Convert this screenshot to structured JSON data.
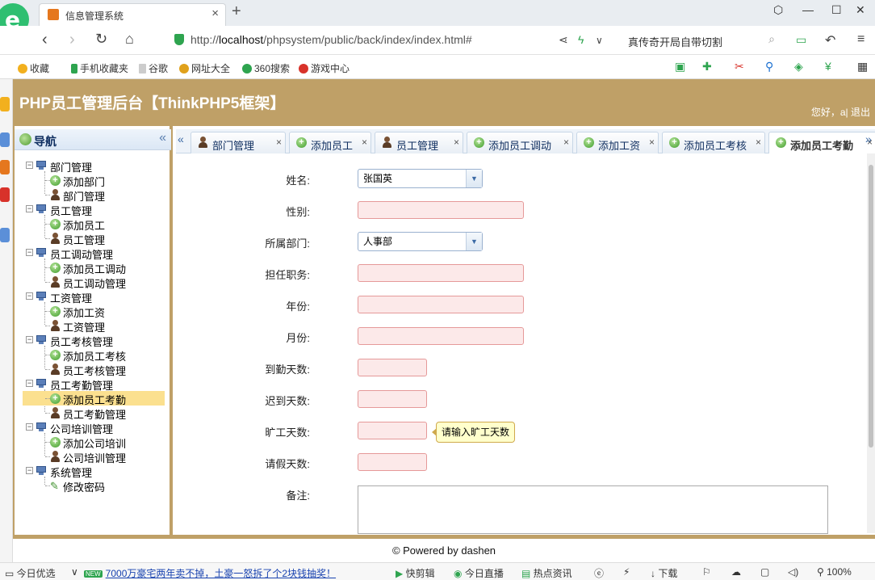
{
  "browser": {
    "tab_title": "信息管理系统",
    "url_host": "localhost",
    "url_prefix": "http://",
    "url_path": "/phpsystem/public/back/index/index.html#",
    "search_text": "真传奇开局自带切割",
    "bookmarks": [
      "收藏",
      "手机收藏夹",
      "谷歌",
      "网址大全",
      "360搜索",
      "游戏中心"
    ]
  },
  "app": {
    "title": "PHP员工管理后台【ThinkPHP5框架】",
    "user_greeting": "您好，a",
    "logout_label": "退出"
  },
  "sidebar": {
    "title": "导航",
    "groups": [
      {
        "label": "部门管理",
        "items": [
          "添加部门",
          "部门管理"
        ]
      },
      {
        "label": "员工管理",
        "items": [
          "添加员工",
          "员工管理"
        ]
      },
      {
        "label": "员工调动管理",
        "items": [
          "添加员工调动",
          "员工调动管理"
        ]
      },
      {
        "label": "工资管理",
        "items": [
          "添加工资",
          "工资管理"
        ]
      },
      {
        "label": "员工考核管理",
        "items": [
          "添加员工考核",
          "员工考核管理"
        ]
      },
      {
        "label": "员工考勤管理",
        "items": [
          "添加员工考勤",
          "员工考勤管理"
        ]
      },
      {
        "label": "公司培训管理",
        "items": [
          "添加公司培训",
          "公司培训管理"
        ]
      },
      {
        "label": "系统管理",
        "items": [
          "修改密码"
        ]
      }
    ],
    "selected": "添加员工考勤"
  },
  "tabs": [
    {
      "label": "部门管理",
      "icon": "user-icon"
    },
    {
      "label": "添加员工",
      "icon": "add-icon"
    },
    {
      "label": "员工管理",
      "icon": "user-icon"
    },
    {
      "label": "添加员工调动",
      "icon": "add-icon"
    },
    {
      "label": "添加工资",
      "icon": "add-icon"
    },
    {
      "label": "添加员工考核",
      "icon": "add-icon"
    },
    {
      "label": "添加员工考勤",
      "icon": "add-icon",
      "active": true
    }
  ],
  "form": {
    "fields": [
      {
        "label": "姓名:",
        "type": "select",
        "value": "张国英"
      },
      {
        "label": "性别:",
        "type": "input",
        "value": ""
      },
      {
        "label": "所属部门:",
        "type": "select",
        "value": "人事部"
      },
      {
        "label": "担任职务:",
        "type": "input",
        "value": ""
      },
      {
        "label": "年份:",
        "type": "input",
        "value": ""
      },
      {
        "label": "月份:",
        "type": "input",
        "value": ""
      },
      {
        "label": "到勤天数:",
        "type": "input-short",
        "value": ""
      },
      {
        "label": "迟到天数:",
        "type": "input-short",
        "value": ""
      },
      {
        "label": "旷工天数:",
        "type": "input-short",
        "value": ""
      },
      {
        "label": "请假天数:",
        "type": "input-short",
        "value": ""
      },
      {
        "label": "备注:",
        "type": "textarea",
        "value": ""
      }
    ],
    "tooltip": "请输入旷工天数"
  },
  "footer": {
    "text": "© Powered by dashen"
  },
  "statusbar": {
    "left": "今日优选",
    "news_badge": "NEW",
    "news": "7000万豪宅两年卖不掉，土豪一怒拆了个2块钱抽奖！",
    "items": [
      "快剪辑",
      "今日直播",
      "热点资讯",
      "下载",
      "100%"
    ]
  },
  "colors": {
    "header_bg": "#bfa067",
    "input_invalid_bg": "#fce9e9",
    "selected_bg": "#fbe08f"
  }
}
